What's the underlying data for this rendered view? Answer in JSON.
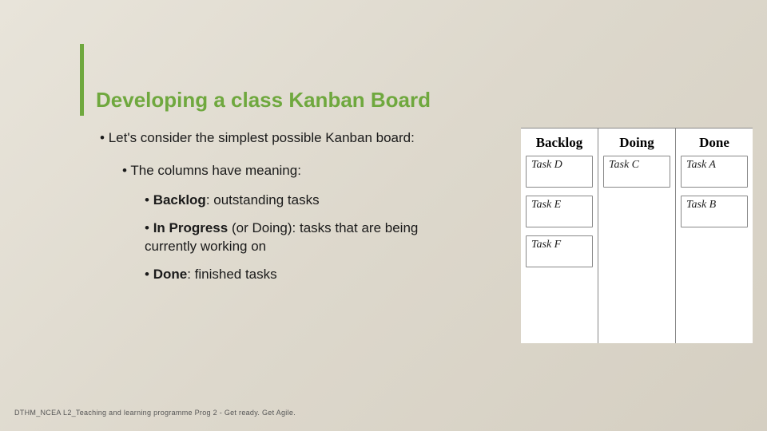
{
  "title": "Developing a class Kanban Board",
  "bullets": {
    "b1": "Let's consider the simplest possible Kanban board:",
    "b2": "The columns have meaning:",
    "b3a_label": "Backlog",
    "b3a_rest": ": outstanding tasks",
    "b3b_label": "In Progress",
    "b3b_rest": " (or Doing): tasks that are being currently working on",
    "b3c_label": "Done",
    "b3c_rest": ": finished tasks"
  },
  "kanban": {
    "columns": [
      {
        "header": "Backlog",
        "tasks": [
          "Task D",
          "Task E",
          "Task F"
        ]
      },
      {
        "header": "Doing",
        "tasks": [
          "Task C"
        ]
      },
      {
        "header": "Done",
        "tasks": [
          "Task A",
          "Task B"
        ]
      }
    ]
  },
  "footer": "DTHM_NCEA L2_Teaching and learning programme Prog 2 - Get ready. Get Agile."
}
